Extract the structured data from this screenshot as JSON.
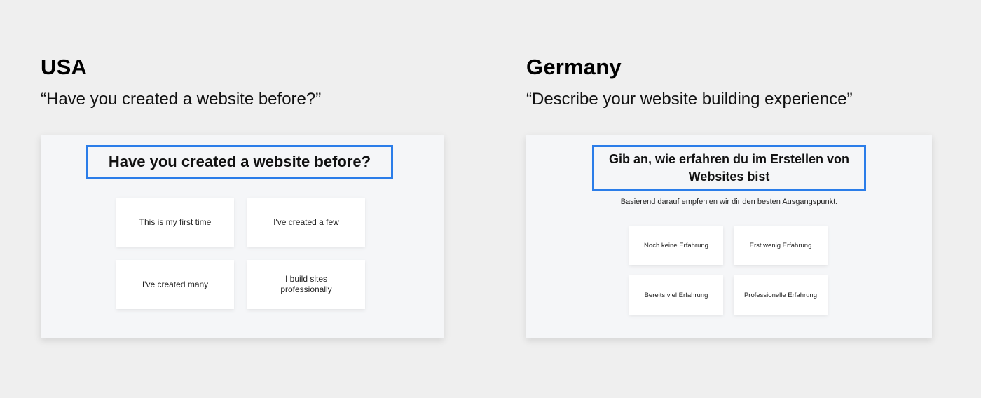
{
  "usa": {
    "country": "USA",
    "subtitle": "“Have you created a website before?”",
    "question": "Have you created a website before?",
    "options": [
      "This is my first time",
      "I've created a few",
      "I've created many",
      "I build sites professionally"
    ]
  },
  "germany": {
    "country": "Germany",
    "subtitle": "“Describe your website building experience”",
    "question": "Gib an, wie erfahren du im Erstellen von Websites bist",
    "hint": "Basierend darauf empfehlen wir dir den besten Ausgangspunkt.",
    "options": [
      "Noch keine Erfahrung",
      "Erst wenig Erfahrung",
      "Bereits viel Erfahrung",
      "Professionelle Erfahrung"
    ]
  },
  "colors": {
    "background": "#efefef",
    "card": "#f5f6f8",
    "highlight_border": "#2b7de9",
    "option": "#ffffff"
  }
}
